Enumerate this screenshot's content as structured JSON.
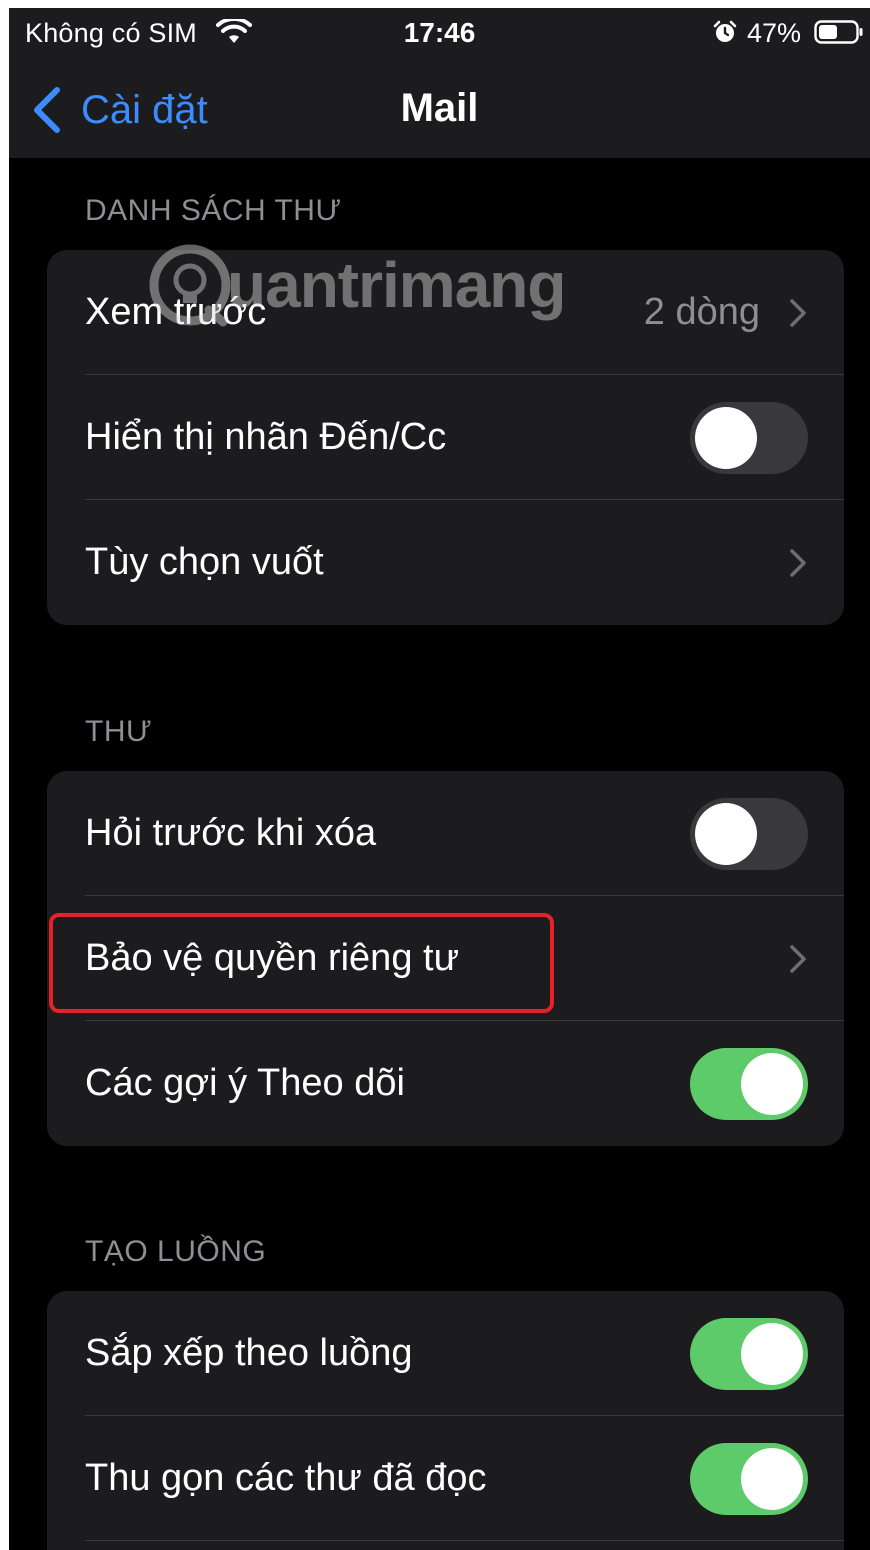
{
  "status_bar": {
    "carrier": "Không có SIM",
    "time": "17:46",
    "battery_percent": "47%",
    "icons": [
      "wifi-icon",
      "alarm-icon",
      "battery-icon"
    ]
  },
  "nav": {
    "back_label": "Cài đặt",
    "title": "Mail"
  },
  "sections": {
    "message_list": {
      "header": "DANH SÁCH THƯ",
      "rows": [
        {
          "label": "Xem trước",
          "value": "2 dòng",
          "accessory": "chevron"
        },
        {
          "label": "Hiển thị nhãn Đến/Cc",
          "accessory": "toggle",
          "on": false
        },
        {
          "label": "Tùy chọn vuốt",
          "accessory": "chevron"
        }
      ]
    },
    "messages": {
      "header": "THƯ",
      "rows": [
        {
          "label": "Hỏi trước khi xóa",
          "accessory": "toggle",
          "on": false
        },
        {
          "label": "Bảo vệ quyền riêng tư",
          "accessory": "chevron",
          "highlighted": true
        },
        {
          "label": "Các gợi ý Theo dõi",
          "accessory": "toggle",
          "on": true
        }
      ]
    },
    "threading": {
      "header": "TẠO LUỒNG",
      "rows": [
        {
          "label": "Sắp xếp theo luồng",
          "accessory": "toggle",
          "on": true
        },
        {
          "label": "Thu gọn các thư đã đọc",
          "accessory": "toggle",
          "on": true
        }
      ]
    }
  },
  "watermark": {
    "text": "uantrimang",
    "logo": "quantrimang-logo"
  },
  "colors": {
    "background": "#000000",
    "group_background": "#1c1c1e",
    "accent_blue": "#3a8cff",
    "toggle_on": "#5ecb6a",
    "toggle_off": "#39393d",
    "highlight_red": "#e8202a",
    "secondary_text": "#8e8e93"
  }
}
